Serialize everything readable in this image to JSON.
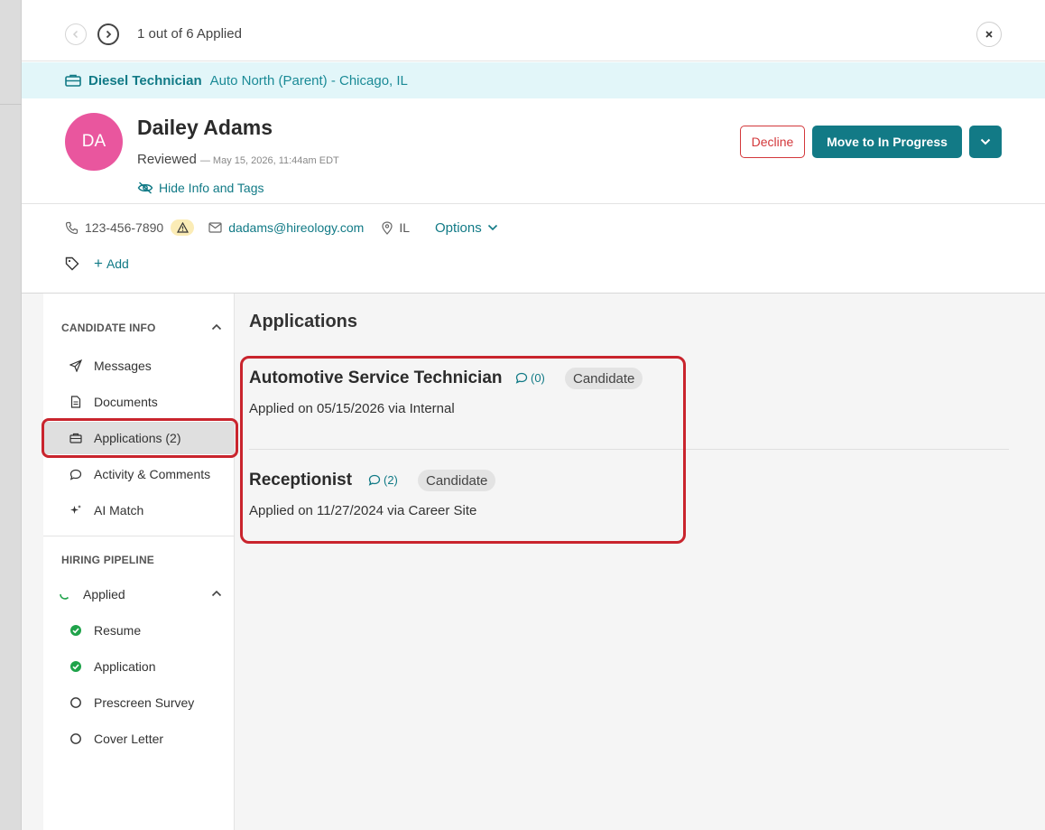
{
  "nav": {
    "count_label": "1 out of 6 Applied",
    "prev_icon": "chevron-left-icon",
    "next_icon": "chevron-right-icon",
    "close_icon": "close-icon"
  },
  "job": {
    "title": "Diesel Technician",
    "location": "Auto North (Parent) - Chicago, IL"
  },
  "candidate": {
    "initials": "DA",
    "name": "Dailey Adams",
    "status": "Reviewed",
    "status_date": "— May 15, 2026, 11:44am EDT",
    "hide_info_label": "Hide Info and Tags",
    "avatar_color": "#e9569e"
  },
  "actions": {
    "decline_label": "Decline",
    "move_label": "Move to In Progress"
  },
  "contact": {
    "phone": "123-456-7890",
    "email": "dadams@hireology.com",
    "location": "IL",
    "options_label": "Options"
  },
  "tags": {
    "add_label": "Add"
  },
  "sidebar": {
    "candidate_info_title": "CANDIDATE INFO",
    "items": [
      {
        "label": "Messages",
        "icon": "send-icon"
      },
      {
        "label": "Documents",
        "icon": "document-icon"
      },
      {
        "label": "Applications (2)",
        "icon": "briefcase-icon"
      },
      {
        "label": "Activity & Comments",
        "icon": "comment-icon"
      },
      {
        "label": "AI Match",
        "icon": "sparkle-icon"
      }
    ],
    "pipeline_title": "HIRING PIPELINE",
    "pipeline_stage": "Applied",
    "pipeline_steps": [
      {
        "label": "Resume",
        "done": true
      },
      {
        "label": "Application",
        "done": true
      },
      {
        "label": "Prescreen Survey",
        "done": false
      },
      {
        "label": "Cover Letter",
        "done": false
      }
    ]
  },
  "main": {
    "title": "Applications",
    "applications": [
      {
        "title": "Automotive Service Technician",
        "comments": "(0)",
        "badge": "Candidate",
        "meta": "Applied on 05/15/2026 via Internal"
      },
      {
        "title": "Receptionist",
        "comments": "(2)",
        "badge": "Candidate",
        "meta": "Applied on 11/27/2024 via Career Site"
      }
    ]
  },
  "colors": {
    "brand_teal": "#127a86",
    "decline_red": "#d3383b",
    "highlight_red": "#c9242d",
    "banner_bg": "#e2f6f9",
    "check_green": "#1fa34a"
  }
}
